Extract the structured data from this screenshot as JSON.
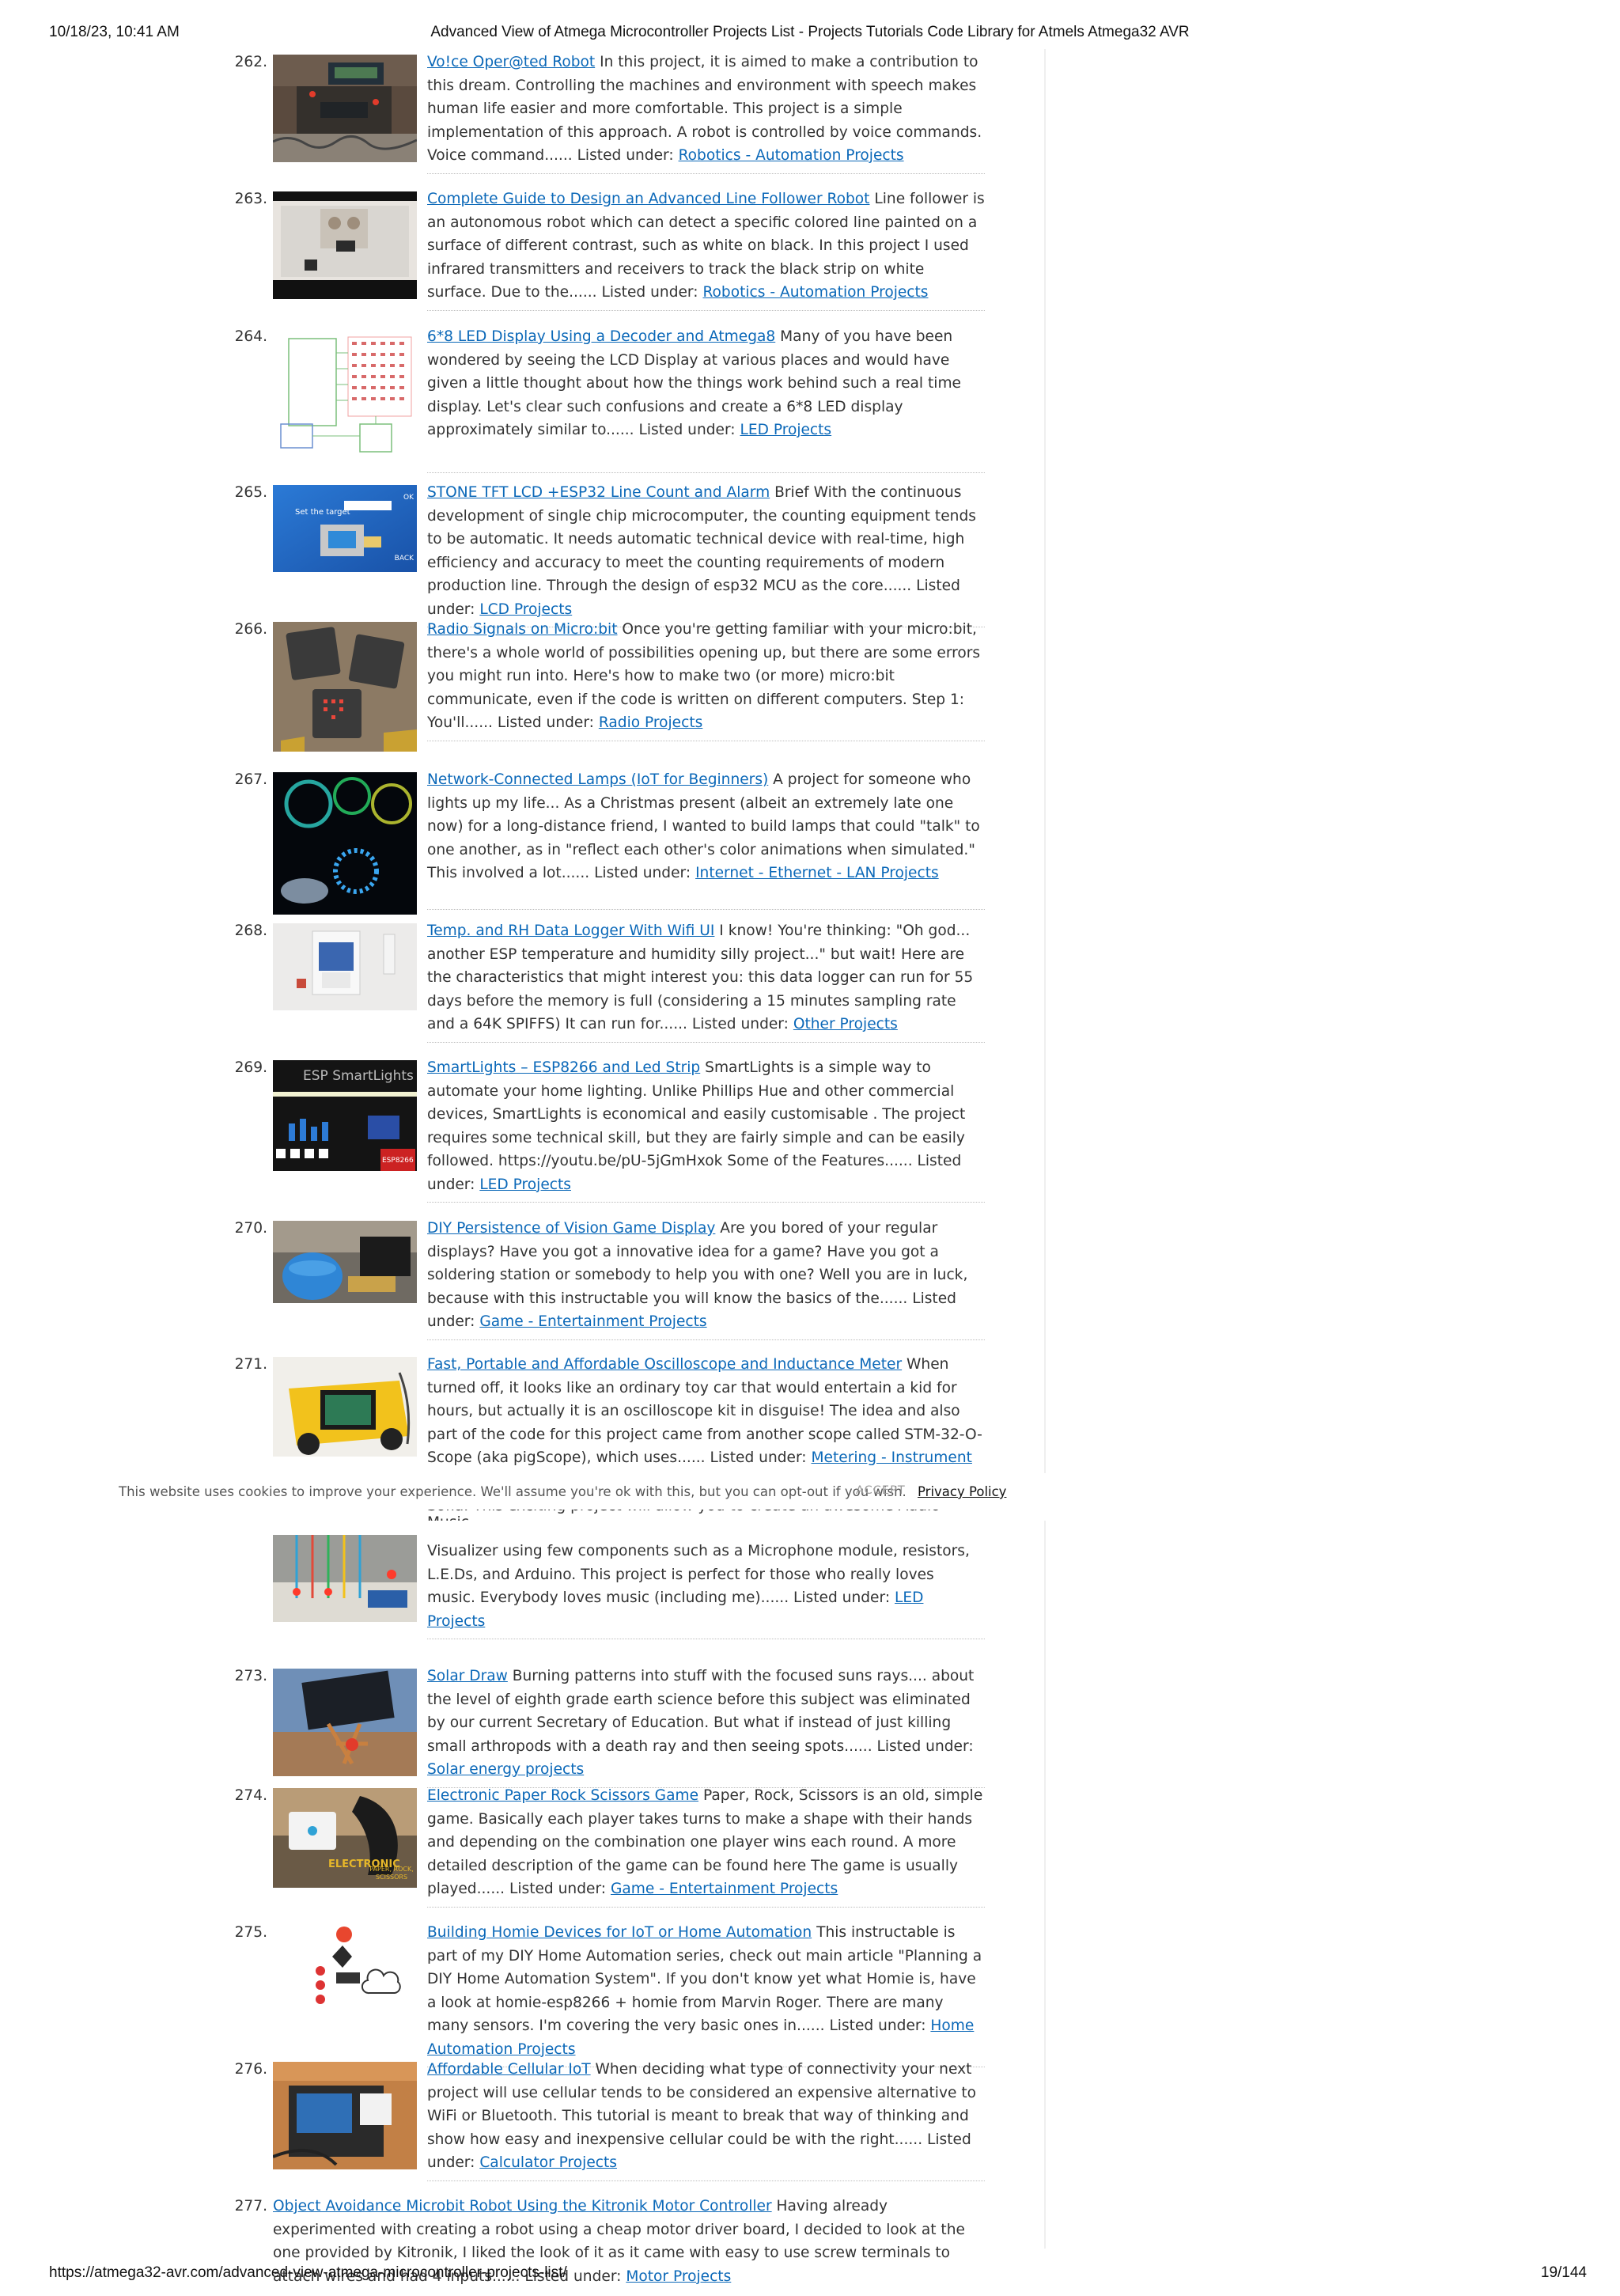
{
  "print_header": {
    "datetime": "10/18/23, 10:41 AM",
    "title": "Advanced View of Atmega Microcontroller Projects List - Projects Tutorials Code Library for Atmels Atmega32 AVR"
  },
  "print_footer": {
    "url": "https://atmega32-avr.com/advanced-view-atmega-microcontroller-projects-list/",
    "page": "19/144"
  },
  "listed_prefix": "Listed under:",
  "entries": [
    {
      "num": "262.",
      "title": "Vo!ce Oper@ted Robot",
      "desc": " In this project, it is aimed to make a contribution to this dream. Controlling the machines and environment with speech makes human life easier and more comfortable. This project is a simple implementation of this approach. A robot is controlled by voice commands. Voice command...... ",
      "category": "Robotics - Automation Projects",
      "thumb": "robot"
    },
    {
      "num": "263.",
      "title": "Complete Guide to Design an Advanced Line Follower Robot",
      "desc": " Line follower is an autonomous robot which can detect a specific colored line painted on a surface of different contrast, such as white on black. In this project I used infrared transmitters and receivers to track the black strip on white surface. Due to the...... ",
      "category": "Robotics - Automation Projects",
      "thumb": "linefollower"
    },
    {
      "num": "264.",
      "title": "6*8 LED Display Using a Decoder and Atmega8",
      "desc": " Many of you have been wondered by seeing the LCD Display at various places and would have given a little thought about how the things work behind such a real time display. Let's clear such confusions and create a 6*8 LED display approximately similar to...... ",
      "category": "LED Projects",
      "thumb": "schematic"
    },
    {
      "num": "265.",
      "title": "STONE TFT LCD +ESP32 Line Count and Alarm",
      "desc": " Brief With the continuous development of single chip microcomputer, the counting equipment tends to be automatic. It needs automatic technical device with real-time, high efficiency and accuracy to meet the counting requirements of modern production line. Through the design of esp32 MCU as the core...... ",
      "category": "LCD Projects",
      "thumb": "tft",
      "thumb_text": "Set the target",
      "thumb_ok": "OK",
      "thumb_back": "BACK"
    },
    {
      "num": "266.",
      "title": "Radio Signals on Micro:bit",
      "desc": " Once you're getting familiar with your micro:bit, there's a whole world of possibilities opening up, but there are some errors you might run into. Here's how to make two (or more) micro:bit communicate, even if the code is written on different computers. Step 1: You'll...... ",
      "category": "Radio Projects",
      "thumb": "microbit"
    },
    {
      "num": "267.",
      "title": "Network-Connected Lamps (IoT for Beginners)",
      "desc": " A project for someone who lights up my life... As a Christmas present (albeit an extremely late one now) for a long-distance friend, I wanted to build lamps that could \"talk\" to one another, as in \"reflect each other's color animations when simulated.\" This involved a lot...... ",
      "category": "Internet - Ethernet - LAN Projects",
      "thumb": "lamps"
    },
    {
      "num": "268.",
      "title": "Temp. and RH Data Logger With Wifi UI",
      "desc": " I know! You're thinking: \"Oh god... another ESP temperature and humidity silly project...\" but wait! Here are the characteristics that might interest you: this data logger can run for 55 days before the memory is full (considering a 15 minutes sampling rate and a 64K SPIFFS) It can run for...... ",
      "category": "Other Projects",
      "thumb": "logger"
    },
    {
      "num": "269.",
      "title": "SmartLights – ESP8266 and Led Strip",
      "desc": " SmartLights is a simple way to automate your home lighting. Unlike Phillips Hue and other commercial devices, SmartLights is economical and easily customisable . The project requires some technical skill, but they are fairly simple and can be easily followed. https://youtu.be/pU-5jGmHxok Some of the Features...... ",
      "category": "LED Projects",
      "thumb": "smartlights",
      "thumb_text": "ESP SmartLights",
      "thumb_chip": "ESP8266"
    },
    {
      "num": "270.",
      "title": "DIY Persistence of Vision Game Display",
      "desc": " Are you bored of your regular displays? Have you got a innovative idea for a game? Have you got a soldering station or somebody to help you with one? Well you are in luck, because with this instructable you will know the basics of the...... ",
      "category": "Game - Entertainment Projects",
      "thumb": "pov"
    },
    {
      "num": "271.",
      "title": "Fast, Portable and Affordable Oscilloscope and Inductance Meter",
      "desc": " When turned off, it looks like an ordinary toy car that would entertain a kid for hours, but actually it is an oscilloscope kit in disguise! The idea and also part of the code for this project came from another scope called STM-32-O-Scope (aka pigScope), which uses...... ",
      "category": "Metering - Instrument Projects",
      "thumb": "scope"
    },
    {
      "num": "272.",
      "title": "",
      "desc": "Visualizer using few components such as a Microphone module, resistors, L.E.Ds, and Arduino. This project is perfect for those who really loves music. Everybody loves music (including me)...... ",
      "category": "LED Projects",
      "thumb": "visualizer",
      "partial_line": "Sofia. This exciting project will allow you to create an awesome Audio Music"
    },
    {
      "num": "273.",
      "title": "Solar Draw",
      "desc": " Burning patterns into stuff with the focused suns rays.... about the level of eighth grade earth science before this subject was eliminated by our current Secretary of Education. But what if instead of just killing small arthropods with a death ray and then seeing spots...... ",
      "category": "Solar energy projects",
      "thumb": "solar"
    },
    {
      "num": "274.",
      "title": "Electronic Paper Rock Scissors Game",
      "desc": " Paper, Rock, Scissors is an old, simple game. Basically each player takes turns to make a shape with their hands and depending on the combination one player wins each round. A more detailed description of the game can be found here The game is usually played...... ",
      "category": "Game - Entertainment Projects",
      "thumb": "rps",
      "thumb_text": "ELECTRONIC",
      "thumb_text2": "PAPER, ROCK, SCISSORS"
    },
    {
      "num": "275.",
      "title": "Building Homie Devices for IoT or Home Automation",
      "desc": " This instructable is part of my DIY Home Automation series, check out main article \"Planning a DIY Home Automation System\". If you don't know yet what Homie is, have a look at homie-esp8266 + homie from Marvin Roger. There are many many sensors. I'm covering the very basic ones in...... ",
      "category": "Home Automation Projects",
      "thumb": "homie"
    },
    {
      "num": "276.",
      "title": "Affordable Cellular IoT",
      "desc": " When deciding what type of connectivity your next project will use cellular tends to be considered an expensive alternative to WiFi or Bluetooth. This tutorial is meant to break that way of thinking and show how easy and inexpensive cellular could be with the right...... ",
      "category": "Calculator Projects",
      "thumb": "cellular"
    },
    {
      "num": "277.",
      "title": "Object Avoidance Microbit Robot Using the Kitronik Motor Controller",
      "desc": " Having already experimented with creating a robot using a cheap motor driver board, I decided to look at the one provided by Kitronik, I liked the look of it as it came with easy to use screw terminals to attach wires and had 4 inputs...... ",
      "category": "Motor Projects",
      "thumb": "none"
    }
  ],
  "cookie": {
    "text": "This website uses cookies to improve your experience. We'll assume you're ok with this, but you can opt-out if you wish.",
    "accept": "ACCEPT",
    "policy": "Privacy Policy"
  }
}
